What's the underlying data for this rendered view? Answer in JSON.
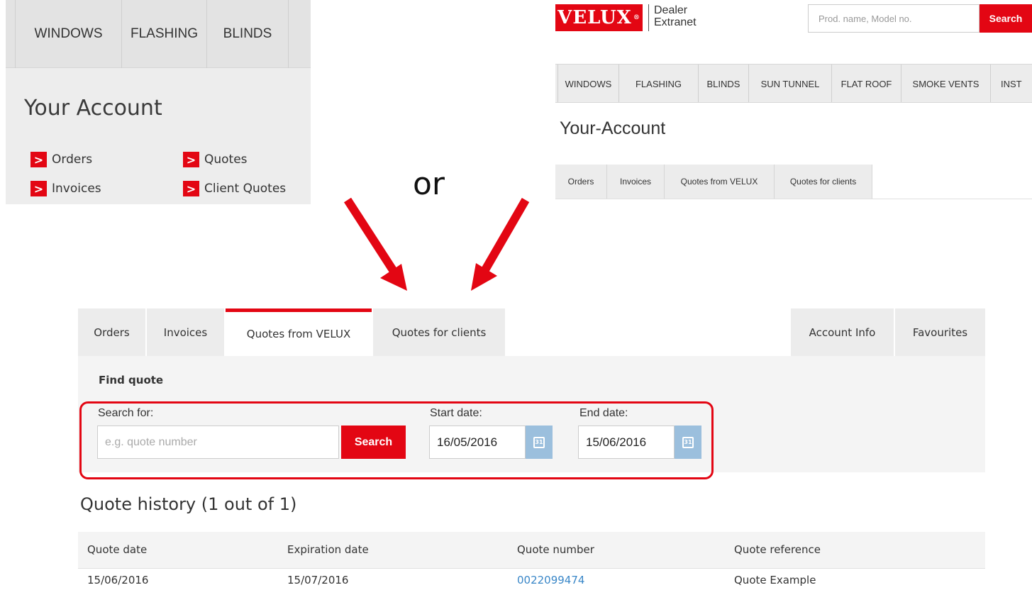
{
  "left_panel": {
    "nav": [
      "WINDOWS",
      "FLASHING",
      "BLINDS"
    ],
    "title": "Your Account",
    "links": [
      "Orders",
      "Quotes",
      "Invoices",
      "Client Quotes"
    ],
    "chevron": ">"
  },
  "connector_text": "or",
  "header": {
    "logo_text": "VELUX",
    "logo_reg": "®",
    "extranet_line1": "Dealer",
    "extranet_line2": "Extranet",
    "search_placeholder": "Prod. name, Model no.",
    "search_button": "Search"
  },
  "right_nav": [
    "WINDOWS",
    "FLASHING",
    "BLINDS",
    "SUN TUNNEL",
    "FLAT ROOF",
    "SMOKE VENTS",
    "INST"
  ],
  "right_account_title": "Your-Account",
  "right_tabs": [
    "Orders",
    "Invoices",
    "Quotes from VELUX",
    "Quotes for clients"
  ],
  "main": {
    "tabs": [
      "Orders",
      "Invoices",
      "Quotes from VELUX",
      "Quotes for clients"
    ],
    "active_tab": "Quotes from VELUX",
    "side_tabs": [
      "Account Info",
      "Favourites"
    ],
    "find_title": "Find quote",
    "search_label": "Search for:",
    "search_placeholder": "e.g. quote number",
    "search_button": "Search",
    "start_label": "Start date:",
    "start_value": "16/05/2016",
    "end_label": "End date:",
    "end_value": "15/06/2016",
    "calendar_icon_text": "31",
    "history_title": "Quote history (1 out of 1)",
    "table": {
      "headers": [
        "Quote date",
        "Expiration date",
        "Quote number",
        "Quote reference"
      ],
      "rows": [
        [
          "15/06/2016",
          "15/07/2016",
          "0022099474",
          "Quote Example"
        ]
      ]
    }
  },
  "colors": {
    "brand_red": "#e30613",
    "calendar_blue": "#9bbfdd",
    "link_blue": "#3a87c8",
    "panel_gray": "#ececec"
  },
  "icons": [
    "chevron-right-icon",
    "calendar-icon",
    "arrow-icon"
  ]
}
